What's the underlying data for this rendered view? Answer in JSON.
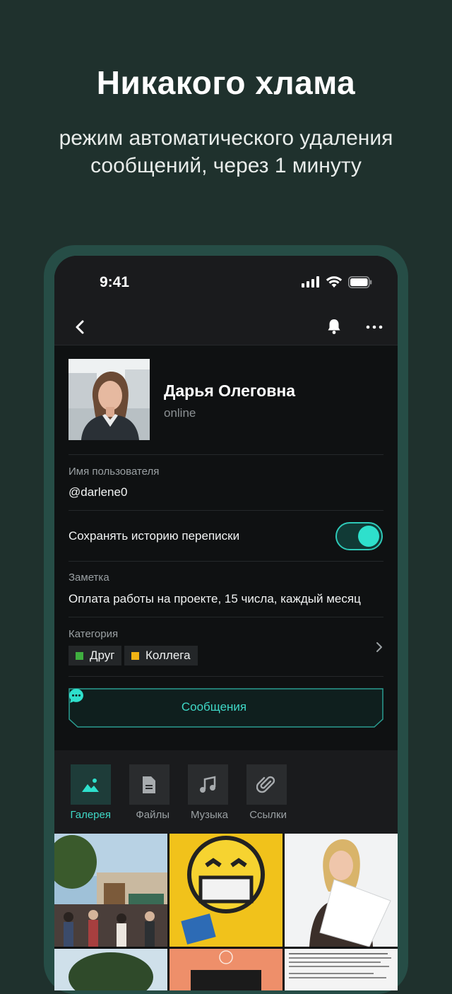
{
  "promo": {
    "headline": "Никакого хлама",
    "subline": "режим автоматического удаления сообщений, через 1 минуту"
  },
  "statusbar": {
    "time": "9:41"
  },
  "nav": {
    "back_icon": "chevron-left-icon",
    "bell_icon": "bell-icon",
    "more_icon": "more-horizontal-icon"
  },
  "profile": {
    "name": "Дарья Олеговна",
    "status": "online"
  },
  "fields": {
    "username_label": "Имя пользователя",
    "username_value": "@darlene0",
    "history_label": "Сохранять историю переписки",
    "history_enabled": true,
    "note_label": "Заметка",
    "note_value": "Оплата работы на проекте, 15 числа, каждый месяц",
    "category_label": "Категория",
    "categories": [
      {
        "label": "Друг",
        "color": "#3fae3f"
      },
      {
        "label": "Коллега",
        "color": "#f0b214"
      }
    ]
  },
  "messages_button": {
    "label": "Сообщения",
    "icon": "chat-bubble-icon"
  },
  "media_tabs": [
    {
      "label": "Галерея",
      "icon": "image-icon",
      "active": true
    },
    {
      "label": "Файлы",
      "icon": "file-icon",
      "active": false
    },
    {
      "label": "Музыка",
      "icon": "music-icon",
      "active": false
    },
    {
      "label": "Ссылки",
      "icon": "paperclip-icon",
      "active": false
    }
  ],
  "colors": {
    "accent": "#2ee0cc",
    "background": "#1f312d",
    "surface": "#0f1112"
  }
}
